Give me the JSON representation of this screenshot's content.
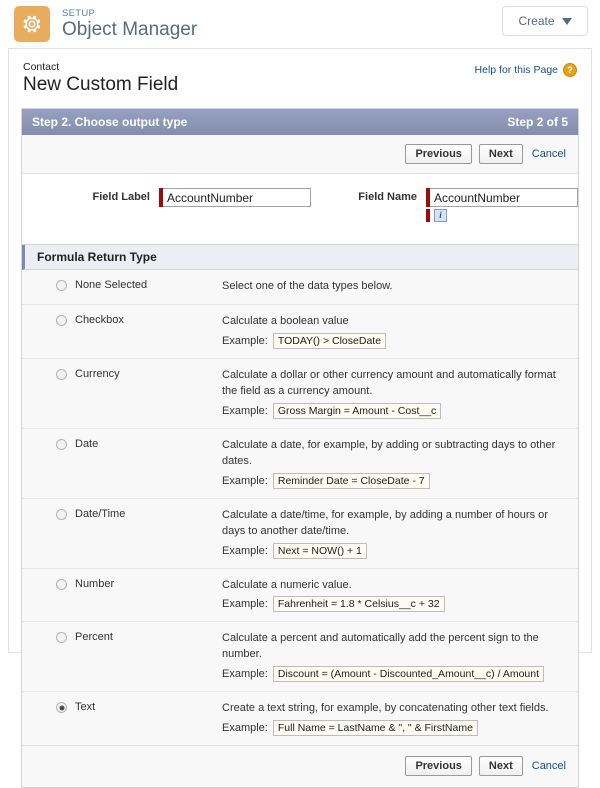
{
  "setup_header": {
    "icon": "gear-icon",
    "eyebrow": "SETUP",
    "title": "Object Manager",
    "create_button": "Create",
    "caret": "chevron-down-icon",
    "icon_bg": "#e8ac5f"
  },
  "page": {
    "breadcrumb": "Contact",
    "title": "New Custom Field",
    "help_link": "Help for this Page",
    "help_icon": "question-badge-icon",
    "help_icon_color": "#e8a317"
  },
  "wizard": {
    "step_title": "Step 2. Choose output type",
    "step_counter": "Step 2 of 5",
    "bar_color": "#8c96b8",
    "previous_label": "Previous",
    "next_label": "Next",
    "cancel_label": "Cancel"
  },
  "fields": {
    "field_label": {
      "label": "Field Label",
      "value": "AccountNumber",
      "placeholder": "",
      "required": true,
      "required_color": "#9e0b0f"
    },
    "field_name": {
      "label": "Field Name",
      "value": "AccountNumber",
      "placeholder": "",
      "required": true,
      "required_color": "#9e0b0f",
      "info_icon": "info-icon",
      "info_icon_glyph": "i"
    }
  },
  "formula_section": {
    "heading": "Formula Return Type",
    "types": [
      {
        "name": "None Selected",
        "selected": false,
        "description": "Select one of the data types below.",
        "example_label": "",
        "example": ""
      },
      {
        "name": "Checkbox",
        "selected": false,
        "description": "Calculate a boolean value",
        "example_label": "Example:",
        "example": "TODAY() > CloseDate"
      },
      {
        "name": "Currency",
        "selected": false,
        "description": "Calculate a dollar or other currency amount and automatically format the field as a currency amount.",
        "example_label": "Example:",
        "example": "Gross Margin = Amount - Cost__c"
      },
      {
        "name": "Date",
        "selected": false,
        "description": "Calculate a date, for example, by adding or subtracting days to other dates.",
        "example_label": "Example:",
        "example": "Reminder Date = CloseDate - 7"
      },
      {
        "name": "Date/Time",
        "selected": false,
        "description": "Calculate a date/time, for example, by adding a number of hours or days to another date/time.",
        "example_label": "Example:",
        "example": "Next = NOW() + 1"
      },
      {
        "name": "Number",
        "selected": false,
        "description": "Calculate a numeric value.",
        "example_label": "Example:",
        "example": "Fahrenheit = 1.8 * Celsius__c + 32"
      },
      {
        "name": "Percent",
        "selected": false,
        "description": "Calculate a percent and automatically add the percent sign to the number.",
        "example_label": "Example:",
        "example": "Discount = (Amount - Discounted_Amount__c) / Amount"
      },
      {
        "name": "Text",
        "selected": true,
        "description": "Create a text string, for example, by concatenating other text fields.",
        "example_label": "Example:",
        "example": "Full Name = LastName & \", \" & FirstName"
      }
    ]
  }
}
